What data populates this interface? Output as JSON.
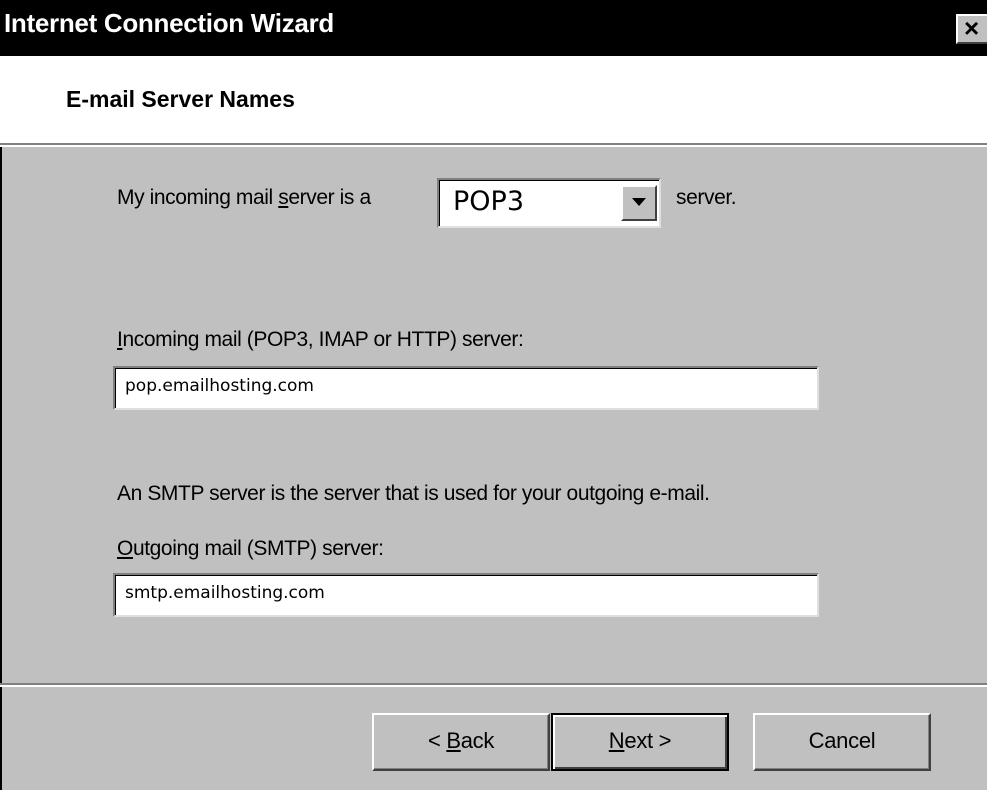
{
  "window": {
    "title": "Internet Connection Wizard",
    "close_glyph": "✕"
  },
  "header": {
    "heading": "E-mail Server Names"
  },
  "server_type": {
    "prefix": "My incoming mail server is a",
    "access_key": "s",
    "selected": "POP3",
    "suffix": "server.",
    "dropdown_icon": "chevron-down-icon"
  },
  "incoming": {
    "label": "Incoming mail (POP3, IMAP or HTTP) server:",
    "access_key": "I",
    "value": "pop.emailhosting.com"
  },
  "smtp_note": "An SMTP server is the server that is used for your outgoing e-mail.",
  "outgoing": {
    "label": "Outgoing mail (SMTP) server:",
    "access_key": "O",
    "value": "smtp.emailhosting.com"
  },
  "buttons": {
    "back": "< Back",
    "back_access_key": "B",
    "next": "Next >",
    "next_access_key": "N",
    "cancel": "Cancel"
  },
  "colors": {
    "dialog_face": "#c0c0c0",
    "title_bar": "#000000",
    "header_bg": "#ffffff"
  }
}
